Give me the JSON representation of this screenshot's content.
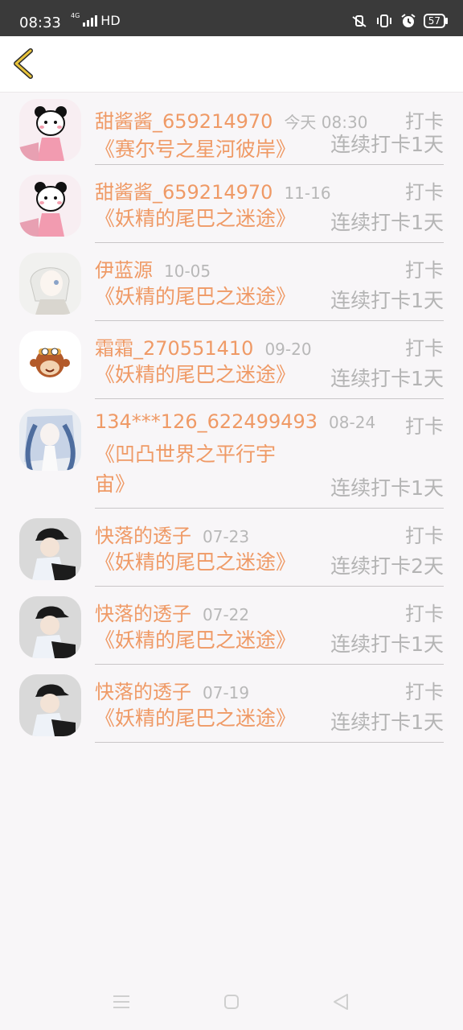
{
  "status_bar": {
    "time": "08:33",
    "network_small": "4G",
    "network_hd": "HD",
    "battery": "57",
    "icons": [
      "signal-icon",
      "vibrate-off-icon",
      "vibrate-icon",
      "alarm-icon",
      "battery-icon"
    ]
  },
  "header": {
    "back_icon": "chevron-left-icon",
    "accent_color": "#e8c33a"
  },
  "colors": {
    "name": "#ef9a66",
    "meta": "#b4b4b4",
    "divider": "#c9c6c8",
    "background": "#f8f6f8"
  },
  "entries": [
    {
      "name": "甜酱酱_659214970",
      "date": "今天 08:30",
      "tag": "打卡",
      "book": "《赛尔号之星河彼岸》",
      "streak": "连续打卡1天",
      "avatar": "pink-cartoon-avatar"
    },
    {
      "name": "甜酱酱_659214970",
      "date": "11-16",
      "tag": "打卡",
      "book": "《妖精的尾巴之迷途》",
      "streak": "连续打卡1天",
      "avatar": "pink-cartoon-avatar"
    },
    {
      "name": "伊蓝源",
      "date": "10-05",
      "tag": "打卡",
      "book": "《妖精的尾巴之迷途》",
      "streak": "连续打卡1天",
      "avatar": "anime-white-hair-avatar"
    },
    {
      "name": "霜霜_270551410",
      "date": "09-20",
      "tag": "打卡",
      "book": "《妖精的尾巴之迷途》",
      "streak": "连续打卡1天",
      "avatar": "monkey-avatar"
    },
    {
      "name": "134***126_622499493",
      "date": "08-24",
      "tag": "打卡",
      "book": "《凹凸世界之平行宇宙》",
      "streak": "连续打卡1天",
      "avatar": "anime-blue-hair-avatar"
    },
    {
      "name": "快落的透子",
      "date": "07-23",
      "tag": "打卡",
      "book": "《妖精的尾巴之迷途》",
      "streak": "连续打卡2天",
      "avatar": "boy-cap-avatar"
    },
    {
      "name": "快落的透子",
      "date": "07-22",
      "tag": "打卡",
      "book": "《妖精的尾巴之迷途》",
      "streak": "连续打卡1天",
      "avatar": "boy-cap-avatar"
    },
    {
      "name": "快落的透子",
      "date": "07-19",
      "tag": "打卡",
      "book": "《妖精的尾巴之迷途》",
      "streak": "连续打卡1天",
      "avatar": "boy-cap-avatar"
    }
  ],
  "nav_bar": {
    "icons": [
      "menu-icon",
      "home-icon",
      "back-triangle-icon"
    ]
  }
}
